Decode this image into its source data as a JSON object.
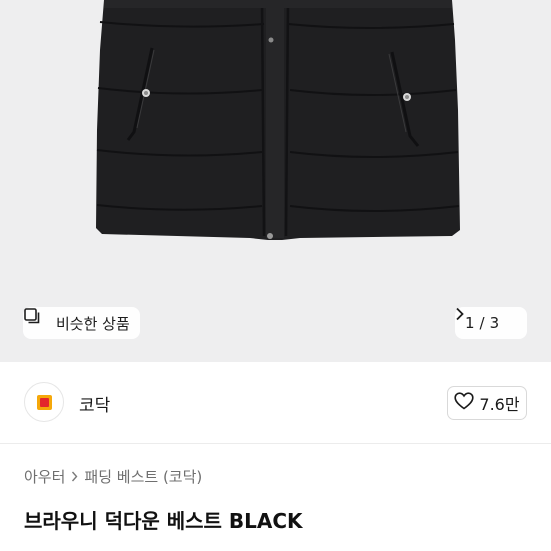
{
  "gallery": {
    "similar_label": "비슷한 상품",
    "similar_icon": "similar-products-icon",
    "page_current": "1",
    "page_separator": "/",
    "page_total": "3",
    "next_icon": "chevron-right-icon"
  },
  "shop": {
    "name": "코닥",
    "logo_icon": "kodak-logo",
    "like_icon": "heart-outline-icon",
    "like_count": "7.6만"
  },
  "breadcrumb": {
    "items": [
      "아우터",
      "패딩 베스트 (코닥)"
    ],
    "separator_icon": "chevron-right-icon"
  },
  "product": {
    "title": "브라우니 덕다운 베스트 BLACK"
  },
  "colors": {
    "hero_background": "#eeeeef",
    "garment": "#1f1f21",
    "logo_orange": "#f5a80a",
    "logo_red": "#e3262b"
  }
}
